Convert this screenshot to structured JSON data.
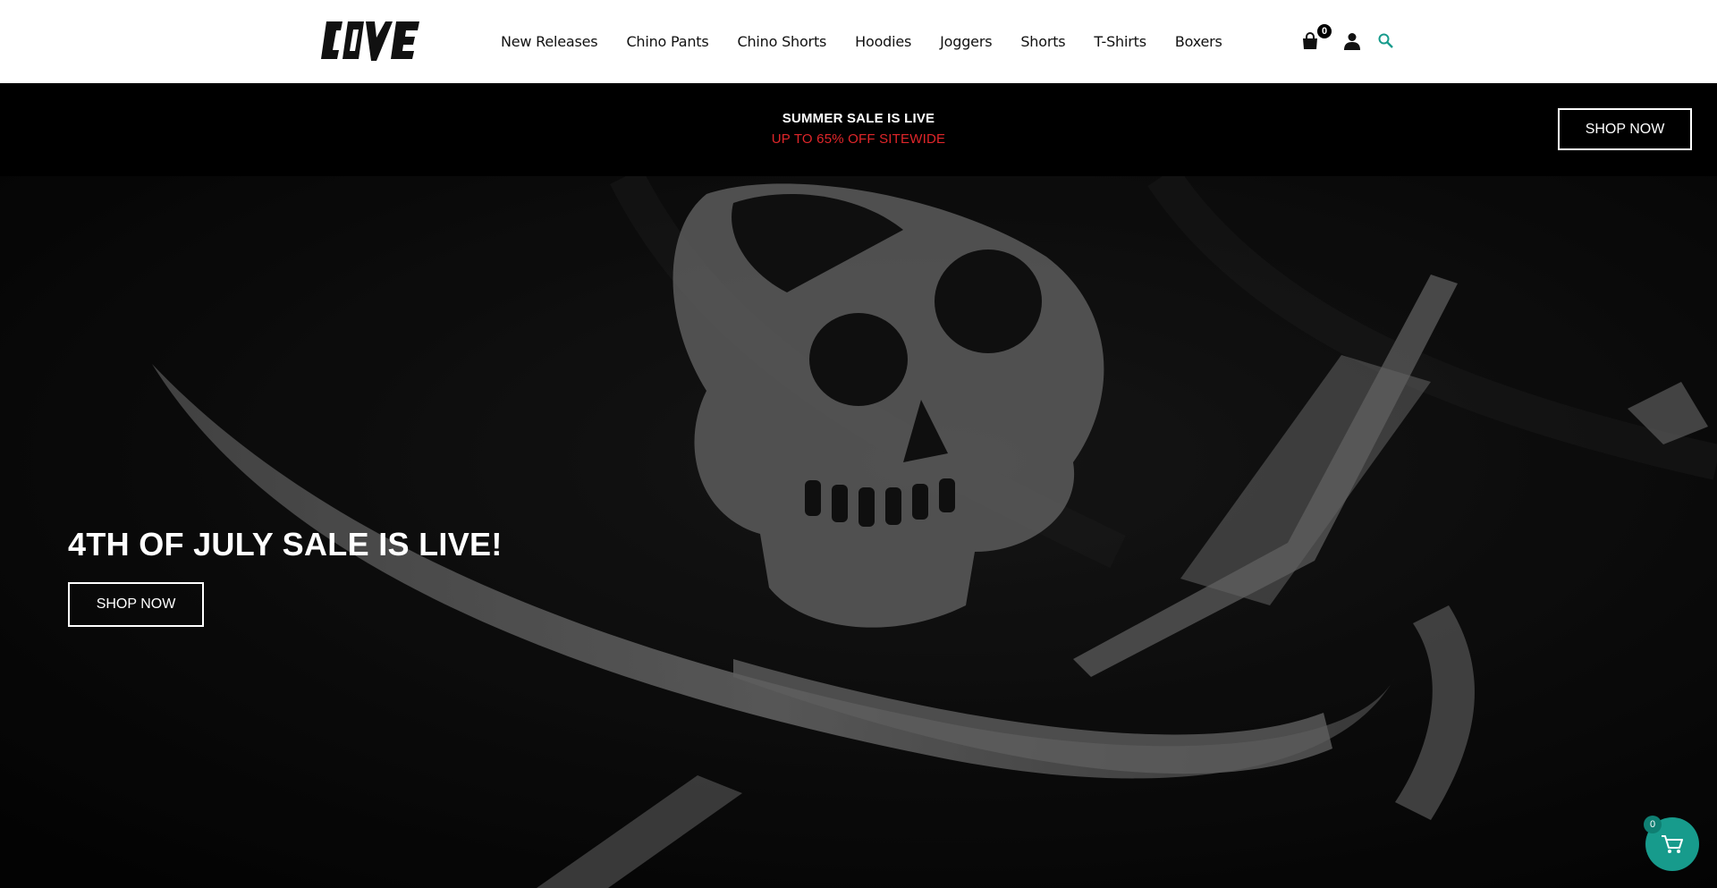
{
  "header": {
    "logo_text": "COVE",
    "nav": [
      "New Releases",
      "Chino Pants",
      "Chino Shorts",
      "Hoodies",
      "Joggers",
      "Shorts",
      "T-Shirts",
      "Boxers"
    ],
    "cart_count": "0",
    "icons": [
      "shopping-bag-icon",
      "user-icon",
      "search-icon"
    ],
    "search_color": "#179b8c"
  },
  "promo": {
    "title": "SUMMER SALE IS LIVE",
    "subtitle": "UP TO 65% OFF SITEWIDE",
    "subtitle_color": "#e0262a",
    "button": "SHOP NOW"
  },
  "hero": {
    "title": "4TH OF JULY SALE IS LIVE!",
    "button": "SHOP NOW"
  },
  "floating_cart": {
    "count": "0",
    "color": "#179b8c",
    "icon": "cart-icon"
  }
}
